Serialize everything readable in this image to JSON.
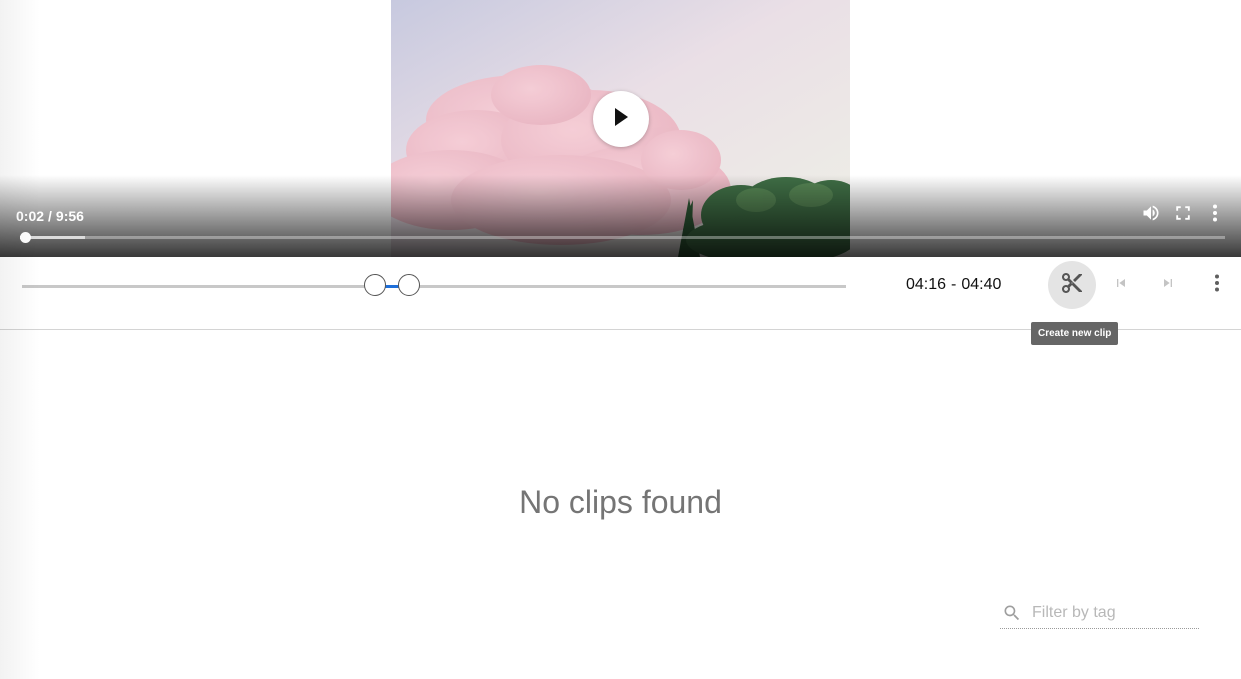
{
  "player": {
    "current_time": "0:02",
    "time_separator": "/",
    "duration": "9:56",
    "progress_fraction": 0.004,
    "buffer_fraction": 0.054,
    "icons": {
      "play": "play-icon",
      "volume": "volume-icon",
      "fullscreen": "fullscreen-icon",
      "more": "more-vert-icon"
    }
  },
  "clip_range": {
    "start": "04:16",
    "separator": "-",
    "end": "04:40",
    "start_fraction": 0.429,
    "end_fraction": 0.47,
    "accent_color": "#1e6fd9"
  },
  "toolbar": {
    "create_clip_icon": "scissors-icon",
    "create_clip_tooltip": "Create new clip",
    "previous_icon": "skip-previous-icon",
    "next_icon": "skip-next-icon",
    "more_icon": "more-vert-icon"
  },
  "clips": {
    "empty_message": "No clips found"
  },
  "filter": {
    "icon": "search-icon",
    "placeholder": "Filter by tag",
    "value": ""
  }
}
